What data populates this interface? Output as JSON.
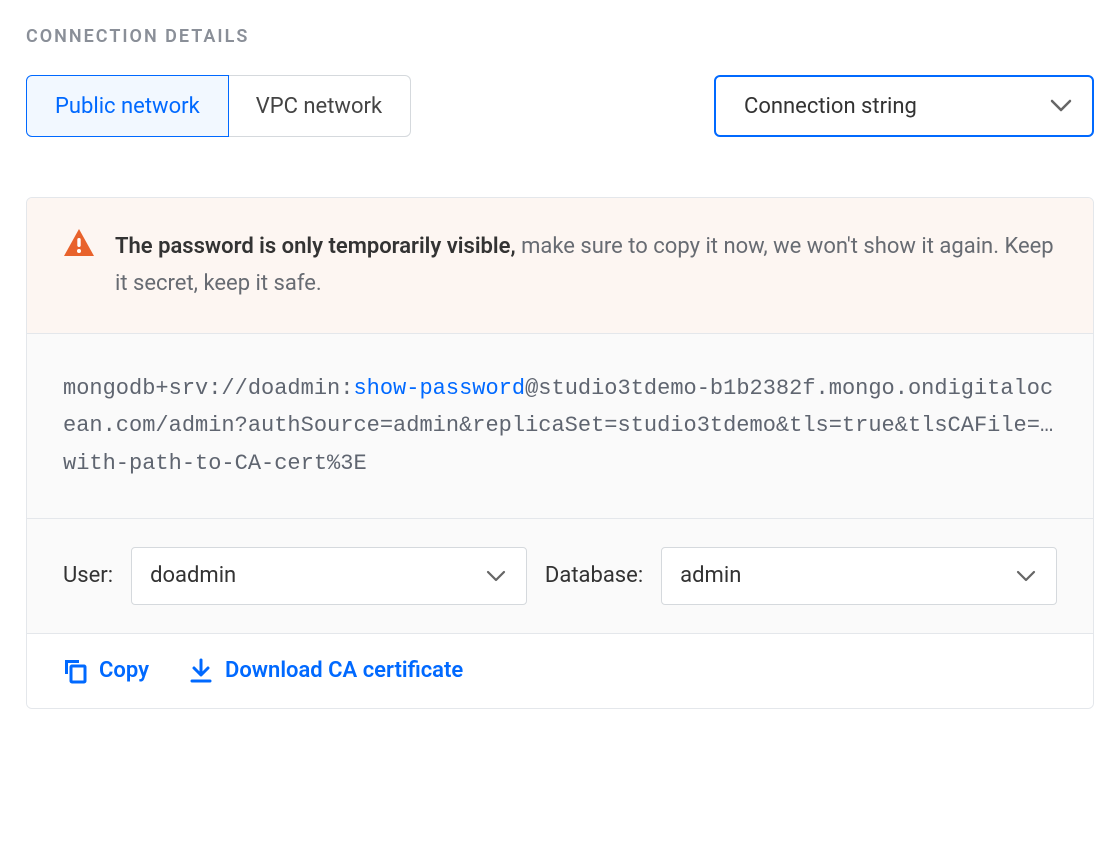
{
  "section_title": "CONNECTION DETAILS",
  "tabs": {
    "public": "Public network",
    "vpc": "VPC network"
  },
  "format_select": {
    "selected": "Connection string"
  },
  "alert": {
    "strong": "The password is only temporarily visible,",
    "rest": " make sure to copy it now, we won't show it again. Keep it secret, keep it safe."
  },
  "connection_string": {
    "prefix": "mongodb+srv://doadmin:",
    "password_link": "show-password",
    "suffix": "@studio3tdemo-b1b2382f.mongo.ondigitalocean.com/admin?authSource=admin&replicaSet=studio3tdemo&tls=true&tlsCAFile=…with-path-to-CA-cert%3E"
  },
  "selectors": {
    "user_label": "User:",
    "user_value": "doadmin",
    "database_label": "Database:",
    "database_value": "admin"
  },
  "actions": {
    "copy": "Copy",
    "download_ca": "Download CA certificate"
  }
}
